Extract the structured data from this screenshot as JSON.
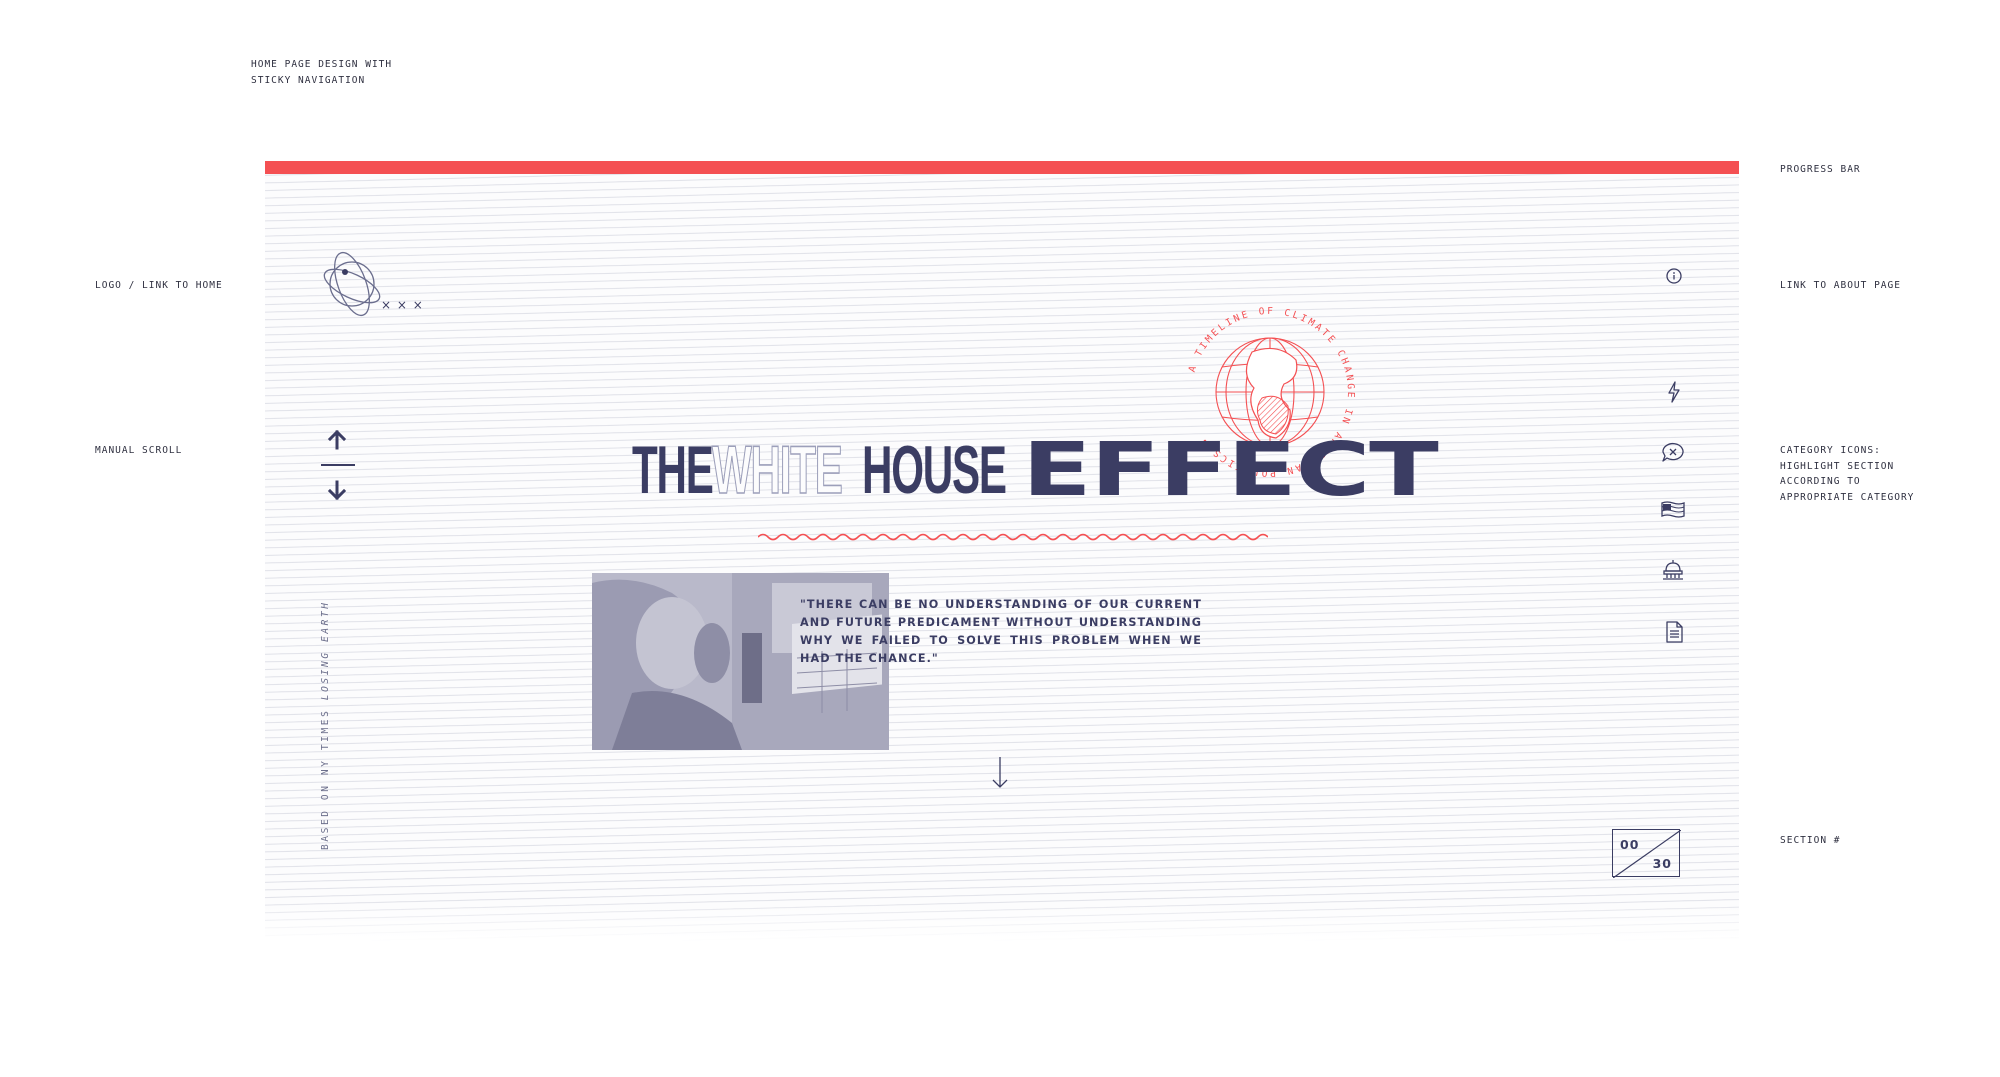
{
  "annotations": {
    "design_title_line1": "HOME PAGE DESIGN WITH",
    "design_title_line2": "STICKY NAVIGATION",
    "progress_bar": "PROGRESS BAR",
    "logo_link": "LOGO / LINK TO HOME",
    "about_link": "LINK TO ABOUT PAGE",
    "manual_scroll": "MANUAL SCROLL",
    "category_icons_line1": "CATEGORY ICONS:",
    "category_icons_line2": "HIGHLIGHT SECTION",
    "category_icons_line3": "ACCORDING TO",
    "category_icons_line4": "APPROPRIATE CATEGORY",
    "section_number": "SECTION #"
  },
  "header": {
    "logo_marks": "× × ×",
    "progress": 1.0
  },
  "hero": {
    "title_the": "THE",
    "title_white": "WHITE",
    "title_house": "HOUSE",
    "title_effect": "EFFECT",
    "badge_text": "A TIMELINE OF CLIMATE CHANGE IN AMERICAN POLITICS •",
    "quote": "\"THERE CAN BE NO UNDERSTANDING OF OUR CURRENT AND FUTURE PREDICAMENT WITHOUT UNDERSTANDING WHY WE FAILED TO SOLVE THIS PROBLEM WHEN WE HAD THE CHANCE.\""
  },
  "sidebar": {
    "credit_prefix": "BASED ON NY TIMES ",
    "credit_italic": "LOSING EARTH"
  },
  "section_counter": {
    "current": "00",
    "total": "30"
  },
  "colors": {
    "accent": "#f45053",
    "navy": "#3b3d63",
    "muted": "#9c9fba"
  },
  "icons": {
    "scroll_up": "arrow-up-icon",
    "scroll_down": "arrow-down-icon",
    "about": "info-circle-icon",
    "categories": [
      "lightning-icon",
      "chat-x-icon",
      "flag-icon",
      "capitol-dome-icon",
      "document-icon"
    ],
    "next": "arrow-down-thin-icon"
  }
}
